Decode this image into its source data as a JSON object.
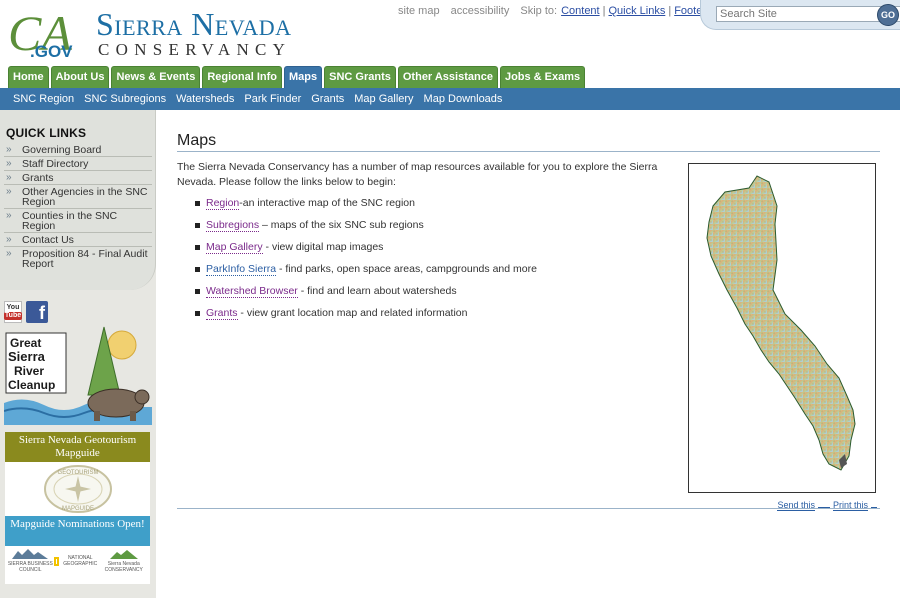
{
  "logo": {
    "ca_text": "CA",
    "gov_text": ".GOV",
    "title_line1": "Sierra Nevada",
    "title_line2": "CONSERVANCY"
  },
  "toplinks": {
    "site_map": "site map",
    "accessibility": "accessibility",
    "skip_to": "Skip to:",
    "content": "Content",
    "quick_links": "Quick Links",
    "footer": "Footer"
  },
  "search": {
    "placeholder": "Search Site",
    "go_label": "GO"
  },
  "tabs": [
    {
      "label": "Home"
    },
    {
      "label": "About Us"
    },
    {
      "label": "News & Events"
    },
    {
      "label": "Regional Info"
    },
    {
      "label": "Maps"
    },
    {
      "label": "SNC Grants"
    },
    {
      "label": "Other Assistance"
    },
    {
      "label": "Jobs & Exams"
    }
  ],
  "subnav": [
    {
      "label": "SNC Region"
    },
    {
      "label": "SNC Subregions"
    },
    {
      "label": "Watersheds"
    },
    {
      "label": "Park Finder"
    },
    {
      "label": "Grants"
    },
    {
      "label": "Map Gallery"
    },
    {
      "label": "Map Downloads"
    }
  ],
  "sidebar": {
    "quick_links_title": "QUICK LINKS",
    "quick_links": [
      {
        "label": "Governing Board"
      },
      {
        "label": "Staff Directory"
      },
      {
        "label": "Grants"
      },
      {
        "label": "Other Agencies in the SNC Region"
      },
      {
        "label": "Counties in the SNC Region"
      },
      {
        "label": "Contact Us"
      },
      {
        "label": "Proposition 84 - Final Audit Report"
      }
    ],
    "youtube_you": "You",
    "youtube_tube": "Tube",
    "facebook_letter": "f",
    "cleanup_text": [
      "Great",
      "Sierra",
      "River",
      "Cleanup"
    ],
    "geotourism_title": "Sierra Nevada Geotourism Mapguide",
    "geotourism_seal_top": "GEOTOURISM",
    "geotourism_seal_bottom": "MAPGUIDE",
    "nominations": "Mapguide Nominations Open!",
    "sponsor_1": "SIERRA BUSINESS COUNCIL",
    "sponsor_2": "NATIONAL GEOGRAPHIC",
    "sponsor_3": "Sierra Nevada CONSERVANCY"
  },
  "main": {
    "title": "Maps",
    "intro": "The Sierra Nevada Conservancy has a number of map resources available for you to explore the Sierra Nevada. Please follow the links below to begin:",
    "links": [
      {
        "link": "Region",
        "desc": "-an interactive map of the SNC region"
      },
      {
        "link": "Subregions",
        "desc": " – maps of the six SNC sub regions"
      },
      {
        "link": "Map Gallery",
        "desc": " - view digital map images"
      },
      {
        "link": "ParkInfo Sierra",
        "desc": " - find parks, open space areas, campgrounds and more"
      },
      {
        "link": "Watershed Browser",
        "desc": " - find and learn about watersheds"
      },
      {
        "link": "Grants",
        "desc": " - view grant location map and related information"
      }
    ],
    "send_this": "Send this",
    "print_this": "Print this"
  },
  "colors": {
    "tab_green": "#5e9a42",
    "nav_blue": "#3a74a8",
    "brand_blue": "#1d6fa5"
  }
}
